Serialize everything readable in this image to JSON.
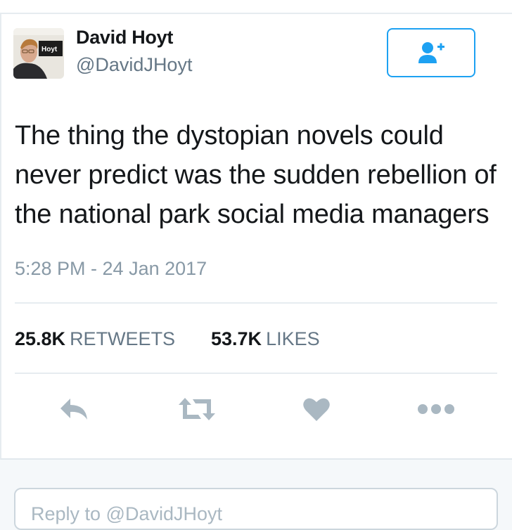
{
  "tweet": {
    "author": {
      "name": "David Hoyt",
      "handle": "@DavidJHoyt",
      "avatar_sign_text": "Hoyt"
    },
    "follow_button": {
      "icon": "follow-user-plus-icon"
    },
    "text": "The thing the dystopian novels could never predict was the sudden rebellion of the national park social media managers",
    "timestamp": "5:28 PM - 24 Jan 2017",
    "stats": {
      "retweets_count": "25.8K",
      "retweets_label": "RETWEETS",
      "likes_count": "53.7K",
      "likes_label": "LIKES"
    },
    "actions": [
      "reply-icon",
      "retweet-icon",
      "heart-icon",
      "more-icon"
    ]
  },
  "reply": {
    "placeholder": "Reply to @DavidJHoyt"
  },
  "colors": {
    "accent": "#1da1f2",
    "action_icon": "#aab8c2",
    "secondary_text": "#657786",
    "primary_text": "#14171a"
  }
}
